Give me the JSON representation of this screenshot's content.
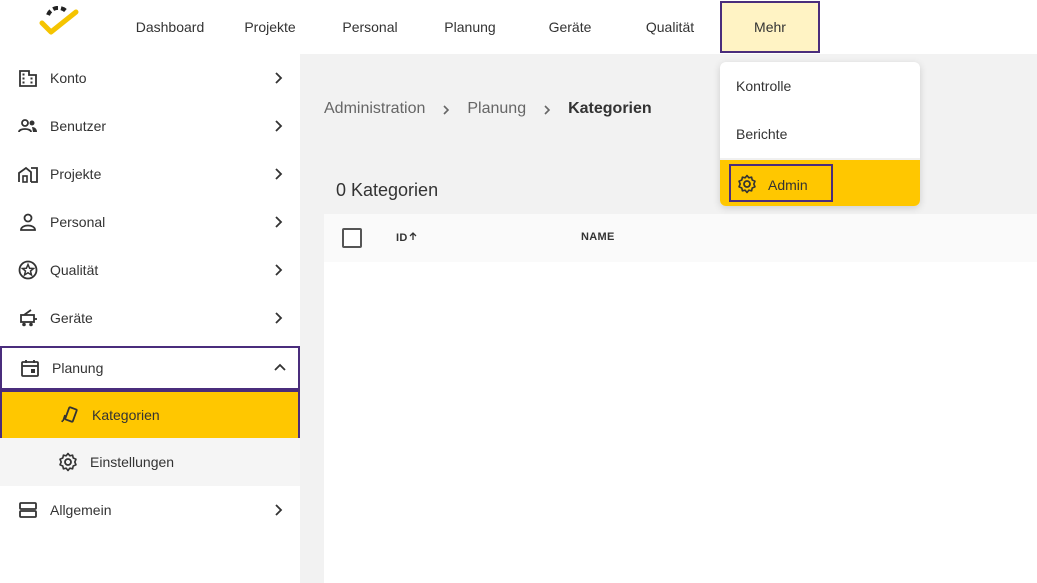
{
  "nav": {
    "items": [
      "Dashboard",
      "Projekte",
      "Personal",
      "Planung",
      "Geräte",
      "Qualität",
      "Mehr"
    ]
  },
  "sidebar": {
    "items": [
      {
        "label": "Konto",
        "icon": "building-icon"
      },
      {
        "label": "Benutzer",
        "icon": "users-icon"
      },
      {
        "label": "Projekte",
        "icon": "house-icon"
      },
      {
        "label": "Personal",
        "icon": "person-icon"
      },
      {
        "label": "Qualität",
        "icon": "star-badge-icon"
      },
      {
        "label": "Geräte",
        "icon": "vehicle-icon"
      },
      {
        "label": "Planung",
        "icon": "calendar-icon"
      },
      {
        "label": "Kategorien",
        "icon": "tag-icon"
      },
      {
        "label": "Einstellungen",
        "icon": "gear-icon"
      },
      {
        "label": "Allgemein",
        "icon": "storage-icon"
      }
    ]
  },
  "breadcrumb": [
    "Administration",
    "Planung",
    "Kategorien"
  ],
  "main": {
    "count_title": "0 Kategorien",
    "columns": [
      "ID",
      "NAME"
    ]
  },
  "dropdown": {
    "items": [
      "Kontrolle",
      "Berichte",
      "Admin"
    ]
  },
  "colors": {
    "accent": "#ffc700",
    "highlight_border": "#4a2d7c",
    "main_bg": "#f2f2f2"
  }
}
